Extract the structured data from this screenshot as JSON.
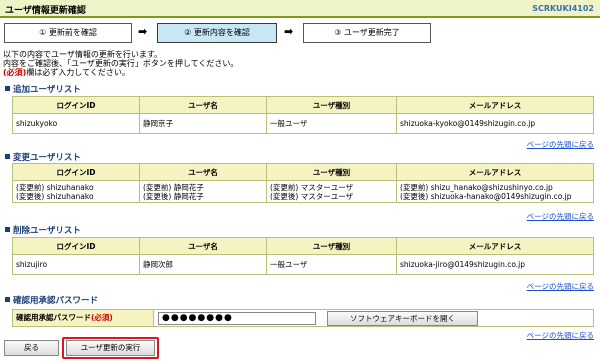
{
  "header": {
    "title": "ユーザ情報更新確認",
    "screen_code": "SCRKUKI4102"
  },
  "steps": [
    {
      "label": "① 更新前を確認"
    },
    {
      "label": "② 更新内容を確認"
    },
    {
      "label": "③ ユーザ更新完了"
    }
  ],
  "step_arrow": "➡",
  "intro": {
    "line1": "以下の内容でユーザ情報の更新を行います。",
    "line2": "内容をご確認後、「ユーザ更新の実行」ボタンを押してください。",
    "line3_req": "(必須)",
    "line3_rest": "欄は必ず入力してください。"
  },
  "columns": [
    "ログインID",
    "ユーザ名",
    "ユーザ種別",
    "メールアドレス"
  ],
  "add_section": {
    "title": "追加ユーザリスト",
    "rows": [
      {
        "login": "shizukyoko",
        "name": "静岡京子",
        "type": "一般ユーザ",
        "mail": "shizuoka-kyoko@0149shizugin.co.jp"
      }
    ]
  },
  "change_section": {
    "title": "変更ユーザリスト",
    "rows": [
      {
        "login_before": "(変更前) shizuhanako",
        "login_after": "(変更後) shizuhanako",
        "name_before": "(変更前) 静岡花子",
        "name_after": "(変更後) 静岡花子",
        "type_before": "(変更前) マスターユーザ",
        "type_after": "(変更後) マスターユーザ",
        "mail_before": "(変更前) shizu_hanako@shizushinyo.co.jp",
        "mail_after": "(変更後) shizuoka-hanako@0149shizugin.co.jp"
      }
    ]
  },
  "delete_section": {
    "title": "削除ユーザリスト",
    "rows": [
      {
        "login": "shizujiro",
        "name": "静岡次郎",
        "type": "一般ユーザ",
        "mail": "shizuoka-jiro@0149shizugin.co.jp"
      }
    ]
  },
  "top_link": "ページの先頭に戻る",
  "password_section": {
    "title": "確認用承認パスワード",
    "label": "確認用承認パスワード",
    "label_req": "(必須)",
    "value": "●●●●●●●●",
    "keyboard_button": "ソフトウェアキーボードを開く"
  },
  "buttons": {
    "back": "戻る",
    "execute": "ユーザ更新の実行"
  }
}
